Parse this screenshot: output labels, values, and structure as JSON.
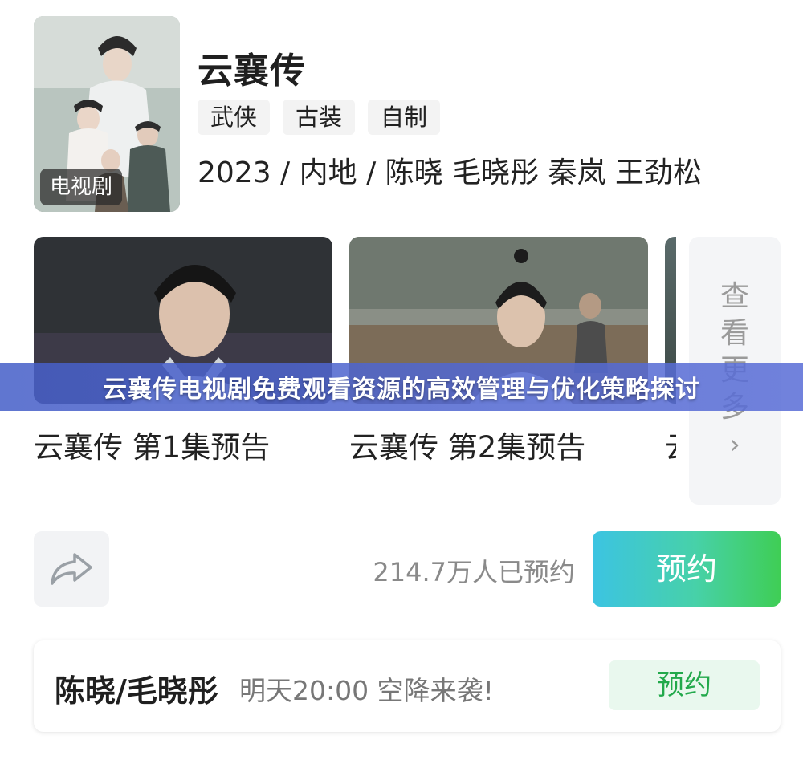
{
  "show": {
    "title": "云襄传",
    "poster_badge": "电视剧",
    "tags": [
      "武侠",
      "古装",
      "自制"
    ],
    "meta": "2023 / 内地 / 陈晓 毛晓彤 秦岚 王劲松"
  },
  "episodes": [
    {
      "title": "云襄传  第1集预告"
    },
    {
      "title": "云襄传  第2集预告"
    },
    {
      "title": "云"
    }
  ],
  "more": {
    "chars": [
      "查",
      "看",
      "更",
      "多"
    ],
    "chevron": "›"
  },
  "banner": {
    "text": "云襄传电视剧免费观看资源的高效管理与优化策略探讨"
  },
  "actions": {
    "share_icon": "share-arrow-icon",
    "reserve_count": "214.7万人已预约",
    "reserve_label": "预约"
  },
  "live": {
    "host": "陈晓/毛晓彤",
    "description": "明天20:00 空降来袭!",
    "button_label": "预约"
  },
  "colors": {
    "reserve_gradient_start": "#3cc4e2",
    "reserve_gradient_end": "#3fce55",
    "live_button_text": "#22a94b",
    "live_button_bg": "#e9f8ee",
    "banner_bg": "#4f65cf"
  }
}
